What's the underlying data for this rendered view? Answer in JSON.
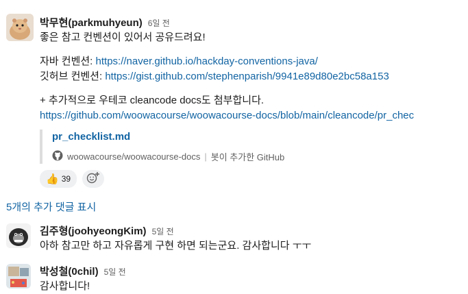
{
  "messages": [
    {
      "author": "박무현(parkmuhyeun)",
      "time": "6일 전",
      "lines": {
        "intro": "좋은 참고 컨벤션이 있어서 공유드려요!",
        "java_label": "자바 컨벤션: ",
        "java_url": "https://naver.github.io/hackday-conventions-java/",
        "git_label": "깃허브 컨벤션: ",
        "git_url": "https://gist.github.com/stephenparish/9941e89d80e2bc58a153",
        "extra": "+ 추가적으로 우테코 cleancode docs도 첨부합니다.",
        "docs_url": "https://github.com/woowacourse/woowacourse-docs/blob/main/cleancode/pr_chec"
      },
      "attachment": {
        "title": "pr_checklist.md",
        "repo": "woowacourse/woowacourse-docs",
        "source": "봇이 추가한 GitHub"
      },
      "reactions": [
        {
          "emoji": "👍",
          "count": "39"
        }
      ]
    },
    {
      "author": "김주형(joohyeongKim)",
      "time": "5일 전",
      "text": "아하 참고만 하고 자유롭게 구현 하면 되는군요. 감사합니다 ㅜㅜ"
    },
    {
      "author": "박성철(0chil)",
      "time": "5일 전",
      "text": "감사합니다!"
    }
  ],
  "more_replies": "5개의 추가 댓글 표시",
  "icons": {
    "github": "github-icon",
    "add_reaction": "add-reaction-icon"
  },
  "colors": {
    "link": "#1264a3",
    "muted": "#616061",
    "reaction_bg": "#eef0f2"
  }
}
